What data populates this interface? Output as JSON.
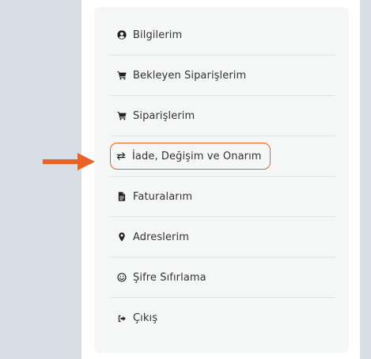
{
  "colors": {
    "background": "#d9dee6",
    "panel": "#ffffff",
    "card": "#f5f6f6",
    "accent": "#e8632a",
    "text": "#333333"
  },
  "menu": {
    "items": [
      {
        "label": "Bilgilerim",
        "icon": "user-circle-icon"
      },
      {
        "label": "Bekleyen Siparişlerim",
        "icon": "cart-icon"
      },
      {
        "label": "Siparişlerim",
        "icon": "cart-icon"
      },
      {
        "label": "İade, Değişim ve Onarım",
        "icon": "exchange-icon",
        "highlighted": true
      },
      {
        "label": "Faturalarım",
        "icon": "file-icon"
      },
      {
        "label": "Adreslerim",
        "icon": "map-pin-icon"
      },
      {
        "label": "Şifre Sıfırlama",
        "icon": "smile-icon"
      },
      {
        "label": "Çıkış",
        "icon": "sign-out-icon"
      }
    ]
  },
  "annotation": {
    "icon": "right-arrow-icon"
  }
}
